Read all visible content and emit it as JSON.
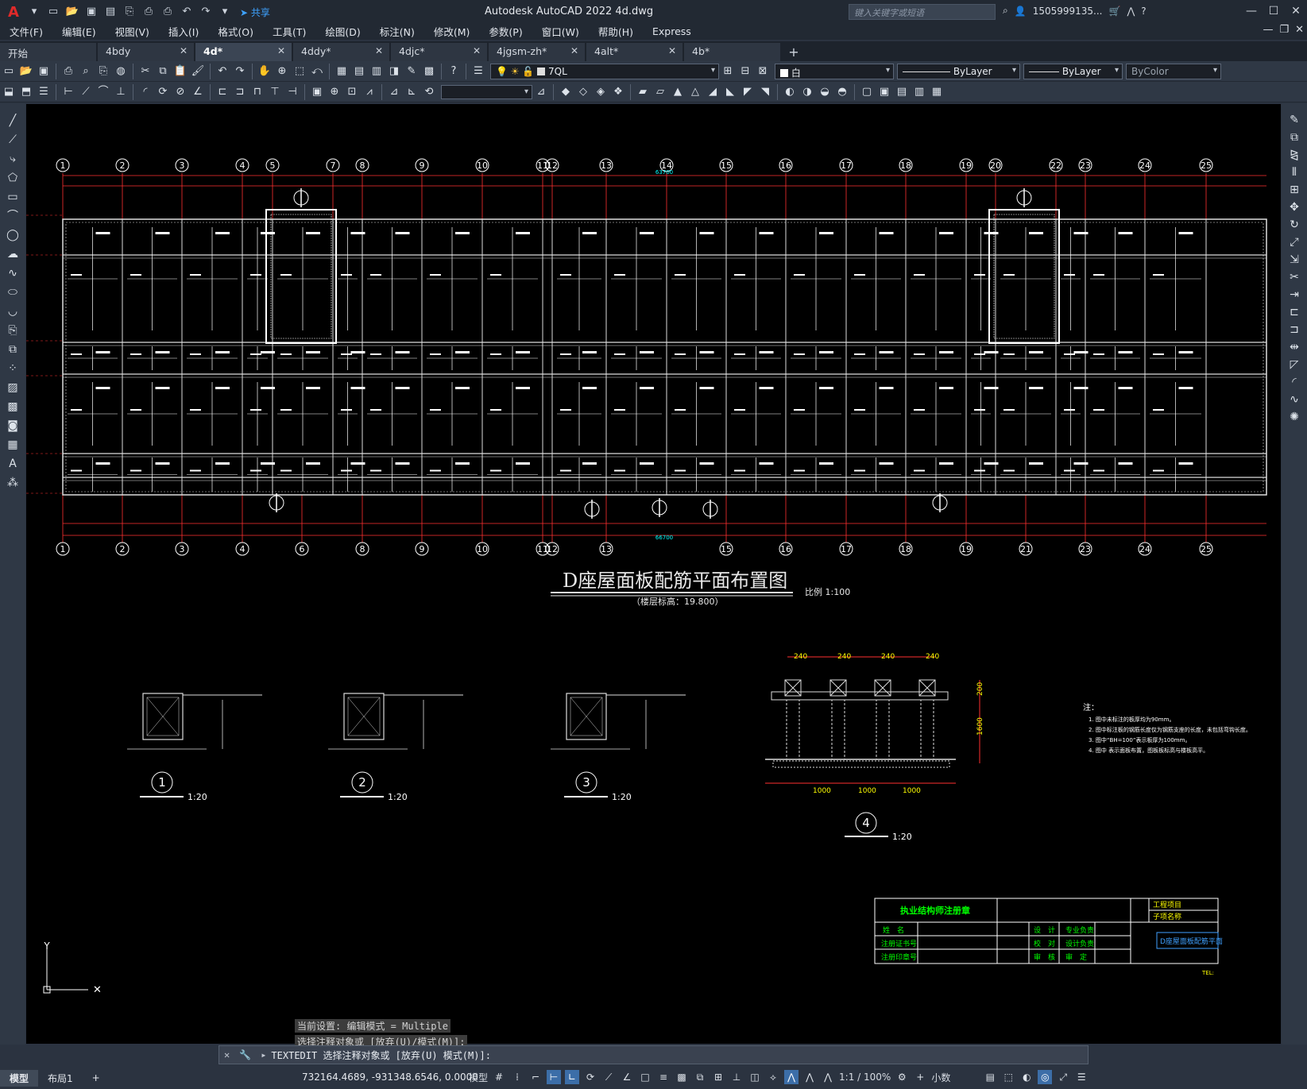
{
  "window": {
    "title": "Autodesk AutoCAD 2022    4d.dwg",
    "search_placeholder": "键入关键字或短语",
    "user": "1505999135...",
    "share_label": "共享"
  },
  "menu": [
    "文件(F)",
    "编辑(E)",
    "视图(V)",
    "插入(I)",
    "格式(O)",
    "工具(T)",
    "绘图(D)",
    "标注(N)",
    "修改(M)",
    "参数(P)",
    "窗口(W)",
    "帮助(H)",
    "Express"
  ],
  "file_tabs": [
    {
      "label": "开始",
      "active": false,
      "closable": false
    },
    {
      "label": "4bdy",
      "active": false,
      "closable": true
    },
    {
      "label": "4d*",
      "active": true,
      "closable": true
    },
    {
      "label": "4ddy*",
      "active": false,
      "closable": true
    },
    {
      "label": "4djc*",
      "active": false,
      "closable": true
    },
    {
      "label": "4jgsm-zh*",
      "active": false,
      "closable": true
    },
    {
      "label": "4alt*",
      "active": false,
      "closable": true
    },
    {
      "label": "4b*",
      "active": false,
      "closable": false
    }
  ],
  "properties": {
    "layer": "7QL",
    "color": "白",
    "linetype": "ByLayer",
    "lineweight": "ByLayer",
    "plotstyle": "ByColor"
  },
  "drawing": {
    "main_title": "D座屋面板配筋平面布置图",
    "scale_text": "比例 1:100",
    "elevation_text": "（楼层标高：19.800）",
    "top_axes": [
      "1",
      "2",
      "3",
      "4",
      "5",
      "7",
      "8",
      "9",
      "10",
      "11",
      "12",
      "13",
      "14",
      "15",
      "16",
      "17",
      "18",
      "19",
      "20",
      "22",
      "23",
      "24",
      "25"
    ],
    "bottom_axes": [
      "1",
      "2",
      "3",
      "4",
      "6",
      "8",
      "9",
      "10",
      "11",
      "12",
      "13",
      "15",
      "16",
      "17",
      "18",
      "19",
      "21",
      "23",
      "24",
      "25"
    ],
    "dim_total_top": "63700",
    "dim_total_bottom": "66700",
    "details": [
      {
        "num": "1",
        "scale": "1:20"
      },
      {
        "num": "2",
        "scale": "1:20"
      },
      {
        "num": "3",
        "scale": "1:20"
      },
      {
        "num": "4",
        "scale": "1:20"
      }
    ],
    "detail4_dims": [
      "240",
      "240",
      "240",
      "240",
      "1000",
      "1000",
      "1000",
      "200",
      "1600"
    ],
    "notes_title": "注：",
    "notes": [
      "1. 图中未标注的板厚均为90mm。",
      "2. 图中标注板的钢筋长度仅为钢筋支座的长度，未包括弯钩长度。",
      "3. 图中“BH=100”表示板厚为100mm。",
      "4. 图中   表示面板布置，图板板标高与楼板高平。"
    ],
    "titleblock": {
      "seal": "执业结构师注册章",
      "project": "工程项目",
      "subproject": "子项名称",
      "name": "姓　名",
      "cert": "注册证书号",
      "seal_no": "注册印章号",
      "design": "设　计",
      "check": "校　对",
      "review": "审　核",
      "discipline": "专业负责",
      "chief": "设计负责",
      "approve": "审　定",
      "sheet_title": "D座屋面板配筋平面",
      "tel": "TEL:"
    }
  },
  "command": {
    "history": [
      "当前设置: 编辑模式 = Multiple",
      "选择注释对象或 [放弃(U)/模式(M)]:"
    ],
    "current": "TEXTEDIT 选择注释对象或 [放弃(U) 模式(M)]:"
  },
  "status": {
    "layouts": [
      "模型",
      "布局1"
    ],
    "coords": "732164.4689, -931348.6546, 0.0000",
    "space": "模型",
    "scale": "1:1 / 100%",
    "units": "小数"
  }
}
